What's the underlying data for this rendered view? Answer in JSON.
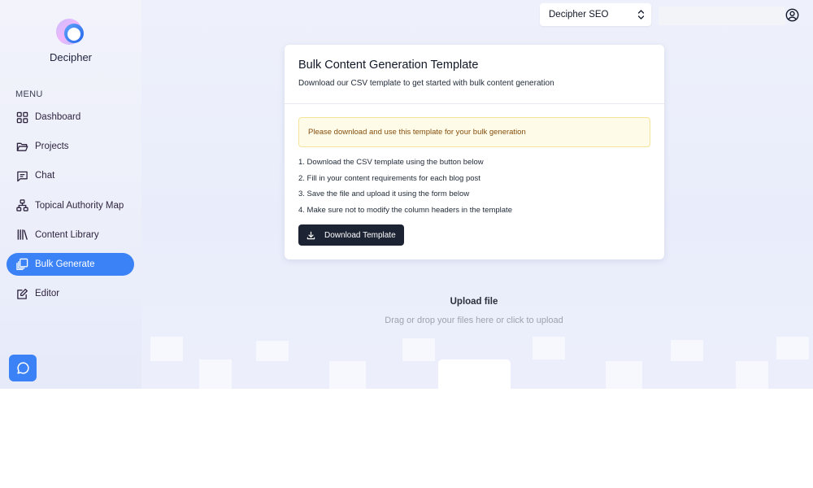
{
  "app": {
    "name": "Decipher"
  },
  "sidebar": {
    "menu_label": "MENU",
    "items": [
      {
        "label": "Dashboard",
        "icon": "dashboard-grid-icon",
        "active": false
      },
      {
        "label": "Projects",
        "icon": "folder-open-icon",
        "active": false
      },
      {
        "label": "Chat",
        "icon": "chat-bubble-icon",
        "active": false
      },
      {
        "label": "Topical Authority Map",
        "icon": "sitemap-icon",
        "active": false
      },
      {
        "label": "Content Library",
        "icon": "library-icon",
        "active": false
      },
      {
        "label": "Bulk Generate",
        "icon": "copy-stack-icon",
        "active": true
      },
      {
        "label": "Editor",
        "icon": "edit-icon",
        "active": false
      }
    ]
  },
  "topbar": {
    "project_select": {
      "selected": "Decipher SEO"
    },
    "search": {
      "value": ""
    },
    "user_icon": "user-circle-icon"
  },
  "template_card": {
    "title": "Bulk Content Generation Template",
    "subtitle": "Download our CSV template to get started with bulk content generation",
    "notice": "Please download and use this template for your bulk generation",
    "steps": [
      "1. Download the CSV template using the button below",
      "2. Fill in your content requirements for each blog post",
      "3. Save the file and upload it using the form below",
      "4. Make sure not to modify the column headers in the template"
    ],
    "download_button": "Download Template"
  },
  "upload": {
    "title": "Upload file",
    "hint": "Drag or drop your files here or click to upload"
  },
  "colors": {
    "accent": "#3b82f6",
    "dark_button": "#1c2333",
    "notice_bg": "#fefce8",
    "notice_text": "#854d0e"
  }
}
